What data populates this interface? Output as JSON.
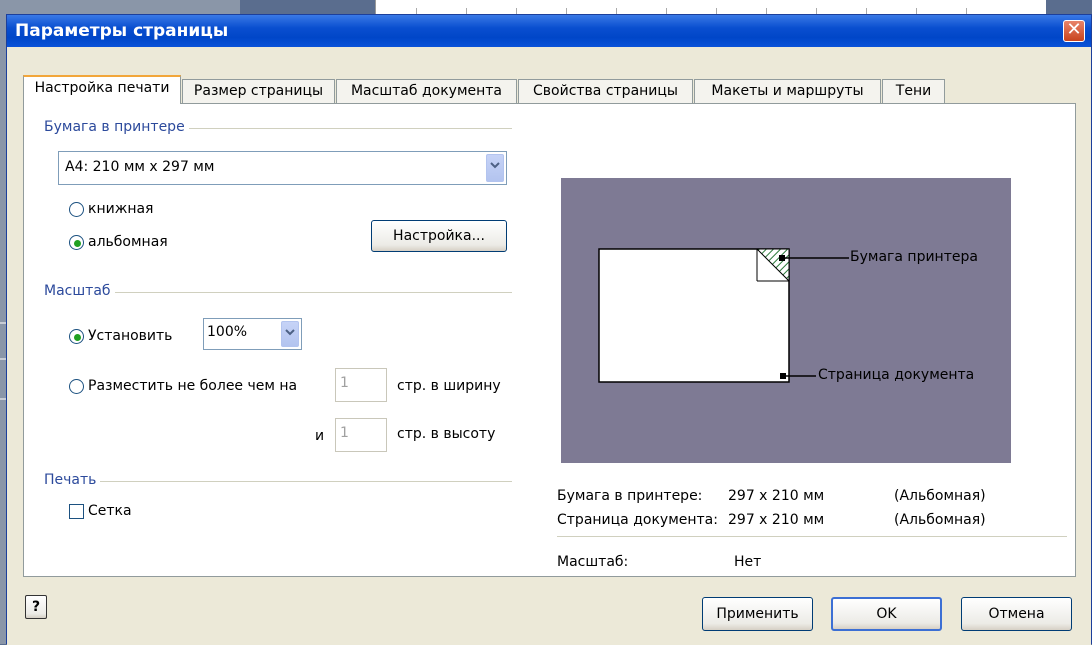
{
  "window": {
    "title": "Параметры страницы"
  },
  "tabs": [
    {
      "label": "Настройка печати",
      "active": true
    },
    {
      "label": "Размер страницы",
      "active": false
    },
    {
      "label": "Масштаб документа",
      "active": false
    },
    {
      "label": "Свойства страницы",
      "active": false
    },
    {
      "label": "Макеты и маршруты",
      "active": false
    },
    {
      "label": "Тени",
      "active": false
    }
  ],
  "paper": {
    "group_label": "Бумага в принтере",
    "size_value": "A4:  210 мм x 297 мм",
    "portrait_label": "книжная",
    "landscape_label": "альбомная",
    "selected": "landscape",
    "setup_button": "Настройка..."
  },
  "scale": {
    "group_label": "Масштаб",
    "set_label": "Установить",
    "set_value": "100%",
    "fit_label": "Разместить не более чем на",
    "fit_width_value": "1",
    "fit_width_suffix": "стр. в ширину",
    "and_label": "и",
    "fit_height_value": "1",
    "fit_height_suffix": "стр. в высоту",
    "selected": "set"
  },
  "print": {
    "group_label": "Печать",
    "grid_label": "Сетка",
    "grid_checked": false
  },
  "preview": {
    "printer_paper_callout": "Бумага принтера",
    "document_page_callout": "Страница документа"
  },
  "info": {
    "printer_paper_label": "Бумага в принтере:",
    "printer_paper_value": "297 x 210 мм",
    "printer_paper_orientation": "(Альбомная)",
    "doc_page_label": "Страница документа:",
    "doc_page_value": "297 x 210 мм",
    "doc_page_orientation": "(Альбомная)",
    "scale_label": "Масштаб:",
    "scale_value": "Нет"
  },
  "footer": {
    "help_icon": "?",
    "apply_button": "Применить",
    "ok_button": "OK",
    "cancel_button": "Отмена"
  },
  "colors": {
    "title_bar": "#0a4fd0",
    "preview_bg": "#7e7a94",
    "group_label": "#2c4a9c",
    "active_tab_accent": "#f2a63a"
  }
}
